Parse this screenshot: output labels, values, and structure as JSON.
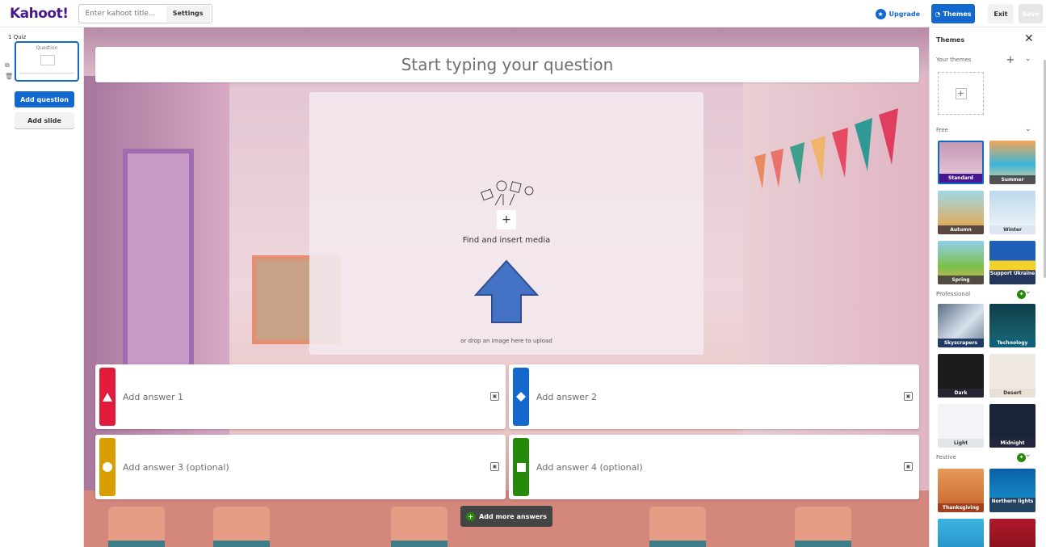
{
  "topbar": {
    "logo": "Kahoot!",
    "title_placeholder": "Enter kahoot title...",
    "settings_label": "Settings",
    "upgrade_label": "Upgrade",
    "themes_label": "Themes",
    "exit_label": "Exit",
    "save_label": "Save"
  },
  "sidebar": {
    "slide_number": "1",
    "slide_type": "Quiz",
    "thumb_label": "Question",
    "add_question_label": "Add question",
    "add_slide_label": "Add slide"
  },
  "editor": {
    "question_placeholder": "Start typing your question",
    "media_label": "Find and insert media",
    "drop_label": "or drop an image here to upload",
    "add_more_answers_label": "Add more answers",
    "answers": [
      {
        "label": "Add answer 1",
        "color": "#e21b3c",
        "shape": "triangle"
      },
      {
        "label": "Add answer 2",
        "color": "#1368ce",
        "shape": "diamond"
      },
      {
        "label": "Add answer 3 (optional)",
        "color": "#d89e00",
        "shape": "circle"
      },
      {
        "label": "Add answer 4 (optional)",
        "color": "#26890c",
        "shape": "square"
      }
    ]
  },
  "themes_panel": {
    "title": "Themes",
    "your_themes_label": "Your themes",
    "free_label": "Free",
    "professional_label": "Professional",
    "festive_label": "Festive",
    "free_themes": [
      "Standard",
      "Summer",
      "Autumn",
      "Winter",
      "Spring",
      "Support Ukraine"
    ],
    "professional_themes": [
      "Skyscrapers",
      "Technology",
      "Dark",
      "Desert",
      "Light",
      "Midnight"
    ],
    "festive_themes": [
      "Thanksgiving",
      "Northern lights"
    ],
    "selected_theme": "Standard"
  },
  "colors": {
    "brand_purple": "#46178f",
    "primary_blue": "#1368ce",
    "green": "#26890c"
  }
}
